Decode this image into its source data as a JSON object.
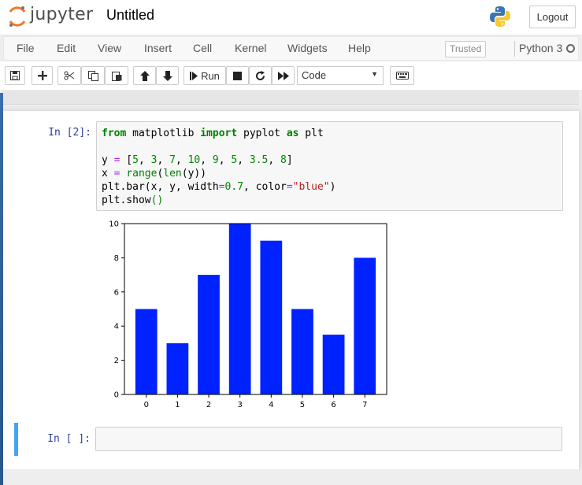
{
  "header": {
    "logo_text": "jupyter",
    "notebook_title": "Untitled",
    "logout_label": "Logout"
  },
  "menubar": {
    "items": [
      "File",
      "Edit",
      "View",
      "Insert",
      "Cell",
      "Kernel",
      "Widgets",
      "Help"
    ],
    "trusted_label": "Trusted",
    "kernel_name": "Python 3"
  },
  "toolbar": {
    "run_label": "Run",
    "cell_type": "Code",
    "icons": [
      "save-icon",
      "plus-icon",
      "cut-icon",
      "copy-icon",
      "paste-icon",
      "arrow-up-icon",
      "arrow-down-icon",
      "step-forward-icon",
      "stop-icon",
      "restart-icon",
      "fast-forward-icon",
      "keyboard-icon"
    ]
  },
  "cells": {
    "cell1": {
      "prompt": "In [2]:",
      "code": {
        "l1": {
          "a": "from",
          "b": " matplotlib ",
          "c": "import",
          "d": " pyplot ",
          "e": "as",
          "f": " plt"
        },
        "l3": {
          "a": "y ",
          "b": "=",
          "c": " [",
          "d": "5",
          "e": ", ",
          "f": "3",
          "g": ", ",
          "h": "7",
          "i": ", ",
          "j": "10",
          "k": ", ",
          "l": "9",
          "m": ", ",
          "n": "5",
          "o": ", ",
          "p": "3.5",
          "q": ", ",
          "r": "8",
          "s": "]"
        },
        "l4": {
          "a": "x ",
          "b": "=",
          "c": " ",
          "d": "range",
          "e": "(",
          "f": "len",
          "g": "(y))"
        },
        "l5": {
          "a": "plt.bar(x, y, width",
          "b": "=",
          "c": "0.7",
          "d": ", color",
          "e": "=",
          "f": "\"blue\"",
          "g": ")"
        },
        "l6": {
          "a": "plt.show",
          "b": "()"
        }
      }
    },
    "cell2": {
      "prompt": "In [ ]:"
    }
  },
  "chart_data": {
    "type": "bar",
    "categories": [
      "0",
      "1",
      "2",
      "3",
      "4",
      "5",
      "6",
      "7"
    ],
    "values": [
      5,
      3,
      7,
      10,
      9,
      5,
      3.5,
      8
    ],
    "bar_width": 0.7,
    "color": "#0022ff",
    "ylim": [
      0,
      10
    ],
    "yticks": [
      "0",
      "2",
      "4",
      "6",
      "8",
      "10"
    ],
    "title": "",
    "xlabel": "",
    "ylabel": "",
    "grid": false
  },
  "colors": {
    "prompt": "#303f9f",
    "selected_cell_border": "#42a5f5",
    "bar": "#0022ff"
  }
}
